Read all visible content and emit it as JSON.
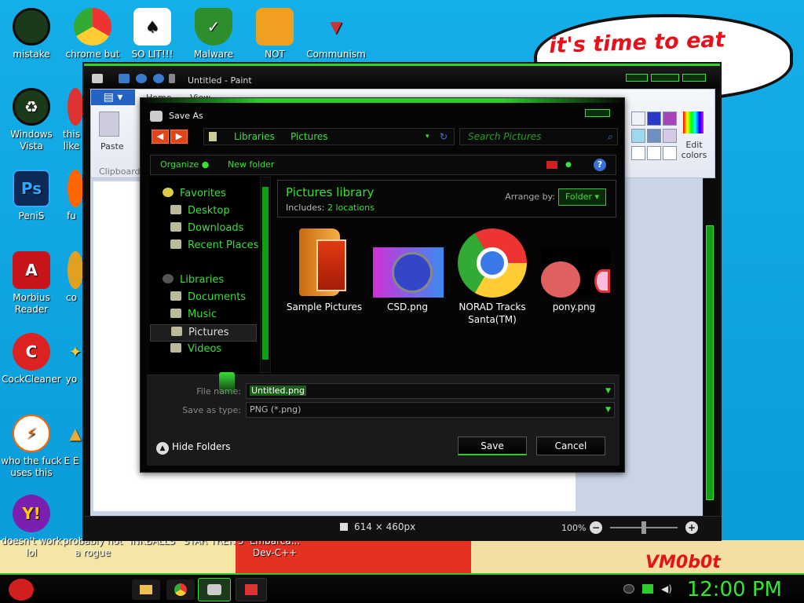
{
  "wallpaper": {
    "speech_bubble": "it's time to eat shit ew",
    "bottom_mark": "VM0b0t"
  },
  "desktop_icons": [
    {
      "label": "mistake"
    },
    {
      "label": "chrome but nor"
    },
    {
      "label": "SO LIT!!!"
    },
    {
      "label": "Malware"
    },
    {
      "label": "NOT"
    },
    {
      "label": "Communism"
    },
    {
      "label": "Windows Vista"
    },
    {
      "label": "this like"
    },
    {
      "label": "PeniS"
    },
    {
      "label": "fu"
    },
    {
      "label": "Morbius Reader"
    },
    {
      "label": "co"
    },
    {
      "label": "CockCleaner"
    },
    {
      "label": "yo"
    },
    {
      "label": "who the fuck uses this"
    },
    {
      "label": "E E"
    },
    {
      "label": "doesn't work lol"
    },
    {
      "label": "probably not a rogue"
    },
    {
      "label": "INKBALLS"
    },
    {
      "label": "STAR TREK 3"
    },
    {
      "label": "Embarca... Dev-C++"
    }
  ],
  "paint": {
    "title": "Untitled - Paint",
    "tabs": [
      "Home",
      "View"
    ],
    "paste_label": "Paste",
    "clipboard_label": "Clipboard",
    "edit_colors_label": "Edit colors",
    "image_size": "614 × 460px",
    "zoom": "100%",
    "swatch_colors": [
      "#1f66e8",
      "#2a3ac8",
      "#a844b8",
      "#9ed8f0",
      "#6f8fc0",
      "#d8c8e8"
    ]
  },
  "dialog": {
    "title": "Save As",
    "breadcrumb": [
      "Libraries",
      "Pictures"
    ],
    "search_placeholder": "Search Pictures",
    "organize_label": "Organize",
    "new_folder_label": "New folder",
    "nav": {
      "favorites": "Favorites",
      "favorites_items": [
        "Desktop",
        "Downloads",
        "Recent Places"
      ],
      "libraries": "Libraries",
      "libraries_items": [
        "Documents",
        "Music",
        "Pictures",
        "Videos"
      ],
      "selected": "Pictures"
    },
    "library_title": "Pictures library",
    "includes_label": "Includes:",
    "includes_value": "2 locations",
    "arrange_by_label": "Arrange by:",
    "arrange_by_value": "Folder",
    "files": [
      {
        "name": "Sample Pictures",
        "icon": "folder-icon"
      },
      {
        "name": "CSD.png",
        "icon": "image-icon"
      },
      {
        "name": "NORAD Tracks Santa(TM)",
        "icon": "chrome-icon"
      },
      {
        "name": "pony.png",
        "icon": "image-icon"
      }
    ],
    "file_name_label": "File name:",
    "file_name_value": "Untitled.png",
    "save_as_type_label": "Save as type:",
    "save_as_type_value": "PNG (*.png)",
    "hide_folders_label": "Hide Folders",
    "save_button": "Save",
    "cancel_button": "Cancel"
  },
  "taskbar": {
    "clock": "12:00 PM"
  },
  "colors": {
    "accent_green": "#2ecb2e",
    "desktop_blue": "#0ea2e0"
  }
}
